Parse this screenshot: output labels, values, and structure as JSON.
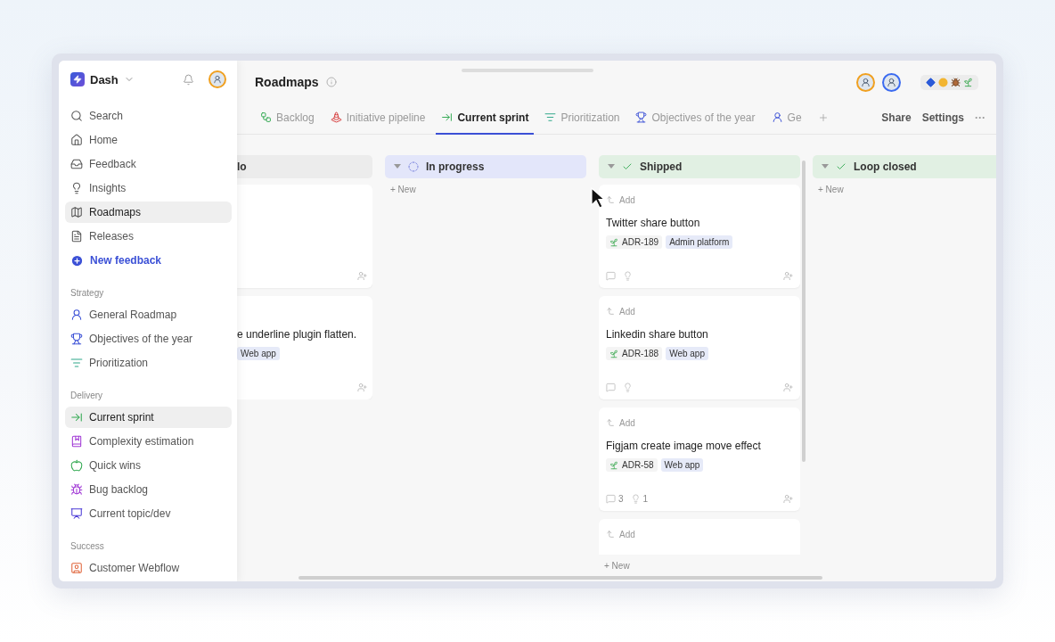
{
  "workspace": {
    "name": "Dash"
  },
  "sidebar": {
    "items": [
      {
        "label": "Search",
        "kind": "nav",
        "selected": false
      },
      {
        "label": "Home",
        "kind": "nav",
        "selected": false
      },
      {
        "label": "Feedback",
        "kind": "nav",
        "selected": false
      },
      {
        "label": "Insights",
        "kind": "nav",
        "selected": false
      },
      {
        "label": "Roadmaps",
        "kind": "nav",
        "selected": true
      },
      {
        "label": "Releases",
        "kind": "nav",
        "selected": false
      },
      {
        "label": "New feedback",
        "kind": "action",
        "selected": false
      }
    ],
    "sections": [
      {
        "title": "Strategy",
        "items": [
          {
            "label": "General Roadmap",
            "selected": false
          },
          {
            "label": "Objectives of the year",
            "selected": false
          },
          {
            "label": "Prioritization",
            "selected": false
          }
        ]
      },
      {
        "title": "Delivery",
        "items": [
          {
            "label": "Current sprint",
            "selected": true
          },
          {
            "label": "Complexity estimation",
            "selected": false
          },
          {
            "label": "Quick wins",
            "selected": false
          },
          {
            "label": "Bug backlog",
            "selected": false
          },
          {
            "label": "Current topic/dev",
            "selected": false
          }
        ]
      },
      {
        "title": "Success",
        "items": [
          {
            "label": "Customer Webflow",
            "selected": false
          }
        ]
      }
    ]
  },
  "page": {
    "title": "Roadmaps"
  },
  "tabs": [
    {
      "label": "Backlog",
      "selected": false
    },
    {
      "label": "Initiative pipeline",
      "selected": false
    },
    {
      "label": "Current sprint",
      "selected": true
    },
    {
      "label": "Prioritization",
      "selected": false
    },
    {
      "label": "Objectives of the year",
      "selected": false
    },
    {
      "label": "Ge",
      "selected": false
    }
  ],
  "actions": [
    "Share",
    "Settings",
    "···"
  ],
  "board": {
    "columns": [
      {
        "title": "lo",
        "kind": "todo",
        "cards": [
          {
            "kind": "blank"
          },
          {
            "title": "e underline plugin flatten.",
            "tags": [
              "Web app"
            ]
          }
        ]
      },
      {
        "title": "In progress",
        "kind": "in_progress",
        "new_label": "+ New"
      },
      {
        "title": "Shipped",
        "kind": "done",
        "new_label": "+ New",
        "cards": [
          {
            "add_label": "Add",
            "title": "Twitter share button",
            "id": "ADR-189",
            "tags": [
              "Admin platform"
            ]
          },
          {
            "add_label": "Add",
            "title": "Linkedin share button",
            "id": "ADR-188",
            "tags": [
              "Web app"
            ]
          },
          {
            "add_label": "Add",
            "title": "Figjam create image move effect",
            "id": "ADR-58",
            "tags": [
              "Web app"
            ],
            "comments": "3",
            "insights": "1"
          },
          {
            "add_label": "Add"
          }
        ]
      },
      {
        "title": "Loop closed",
        "kind": "done",
        "new_label": "+ New"
      }
    ]
  }
}
